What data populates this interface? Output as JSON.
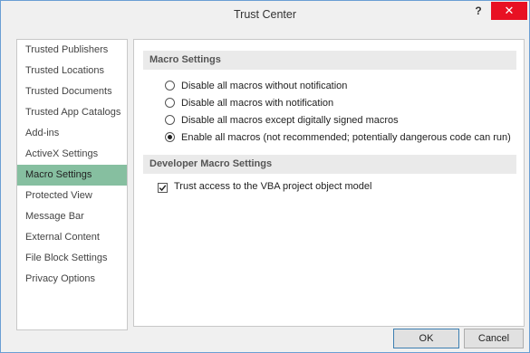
{
  "window": {
    "title": "Trust Center",
    "help": "?",
    "close": "✕"
  },
  "sidebar": {
    "items": [
      {
        "label": "Trusted Publishers"
      },
      {
        "label": "Trusted Locations"
      },
      {
        "label": "Trusted Documents"
      },
      {
        "label": "Trusted App Catalogs"
      },
      {
        "label": "Add-ins"
      },
      {
        "label": "ActiveX Settings"
      },
      {
        "label": "Macro Settings",
        "selected": true
      },
      {
        "label": "Protected View"
      },
      {
        "label": "Message Bar"
      },
      {
        "label": "External Content"
      },
      {
        "label": "File Block Settings"
      },
      {
        "label": "Privacy Options"
      }
    ]
  },
  "macro_settings": {
    "header": "Macro Settings",
    "options": [
      {
        "label": "Disable all macros without notification",
        "checked": false
      },
      {
        "label": "Disable all macros with notification",
        "checked": false
      },
      {
        "label": "Disable all macros except digitally signed macros",
        "checked": false
      },
      {
        "label": "Enable all macros (not recommended; potentially dangerous code can run)",
        "checked": true
      }
    ]
  },
  "developer_settings": {
    "header": "Developer Macro Settings",
    "vba_access": {
      "label": "Trust access to the VBA project object model",
      "checked": true
    }
  },
  "buttons": {
    "ok": "OK",
    "cancel": "Cancel"
  },
  "colors": {
    "selected": "#86bfa0",
    "close": "#e81123",
    "border": "#6a9fd4"
  }
}
